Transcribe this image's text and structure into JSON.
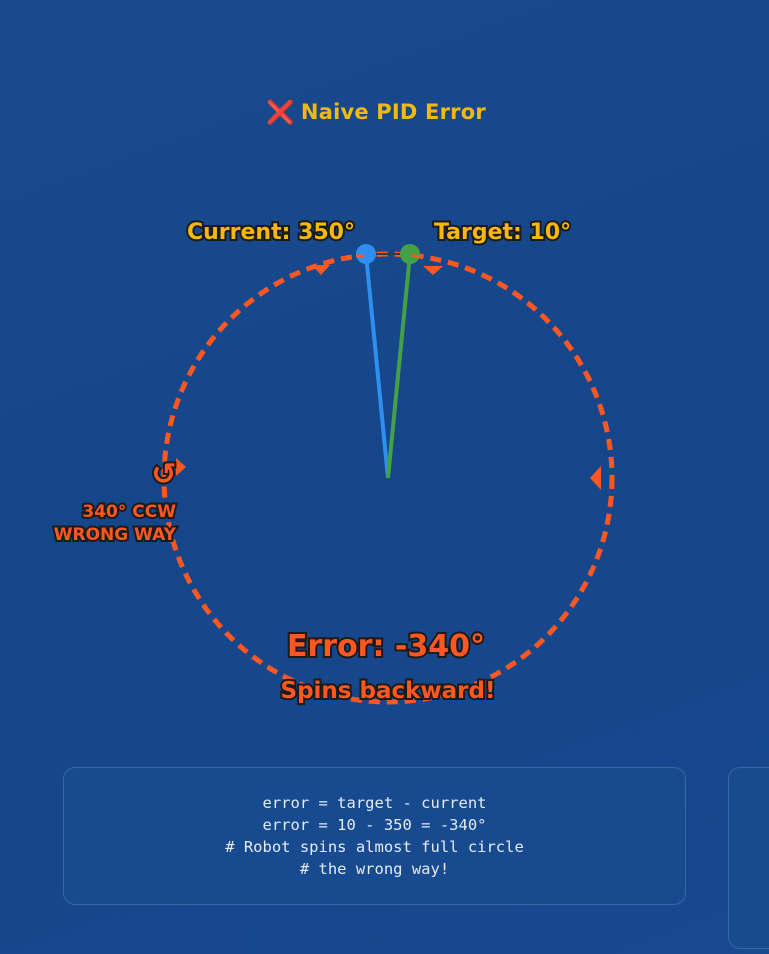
{
  "title": {
    "icon": "cross-mark-icon",
    "icon_glyph": "❌",
    "text": "Naive PID Error"
  },
  "diagram": {
    "current_label": "Current: 350°",
    "target_label": "Target: 10°",
    "current_angle_deg": 350,
    "target_angle_deg": 10,
    "error_label": "Error: -340°",
    "error_sublabel": "Spins backward!",
    "direction_icon": "counterclockwise-arrow-icon",
    "direction_glyph": "↺",
    "direction_line1": "340° CCW",
    "direction_line2": "WRONG WAY",
    "colors": {
      "current": "#2f8ff0",
      "target": "#43a047",
      "error_arc": "#ff5722",
      "label": "#f5b80e",
      "background": "#17478a"
    }
  },
  "code": {
    "lines": [
      "error = target - current",
      "error = 10 - 350 = -340°",
      "# Robot spins almost full circle",
      "# the wrong way!"
    ]
  }
}
